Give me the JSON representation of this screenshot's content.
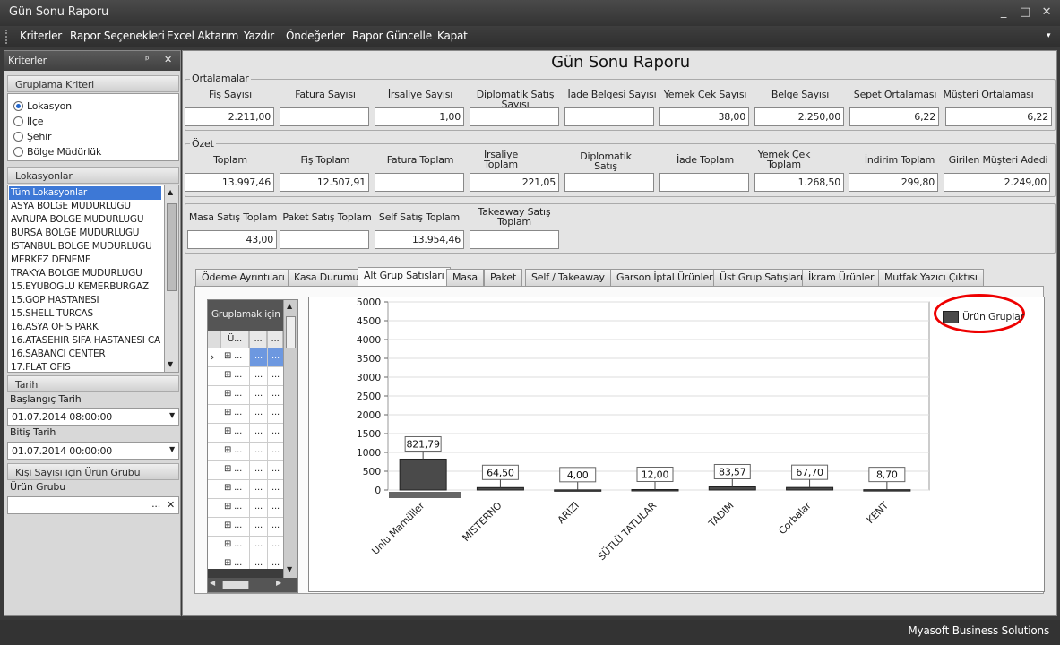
{
  "window": {
    "title": "Gün Sonu Raporu",
    "minimize": "_",
    "maximize": "□",
    "close": "✕"
  },
  "menu": [
    "Kriterler",
    "Rapor Seçenekleri",
    "Excel Aktarım",
    "Yazdır",
    "Öndeğerler",
    "Rapor Güncelle",
    "Kapat"
  ],
  "menu_overflow": "▾",
  "left_panel": {
    "title": "Kriterler",
    "pin": "ᵖ",
    "close": "✕",
    "grouping": {
      "title": "Gruplama Kriteri",
      "options": [
        "Lokasyon",
        "İlçe",
        "Şehir",
        "Bölge Müdürlük"
      ],
      "selected": "Lokasyon"
    },
    "locations": {
      "title": "Lokasyonlar",
      "items": [
        "Tüm Lokasyonlar",
        "ASYA BOLGE MUDURLUGU",
        "AVRUPA BOLGE MUDURLUGU",
        "BURSA BOLGE MUDURLUGU",
        "ISTANBUL BOLGE MUDURLUGU",
        "MERKEZ DENEME",
        "TRAKYA BOLGE MUDURLUGU",
        "15.EYUBOGLU KEMERBURGAZ",
        "15.GOP HASTANESI",
        "15.SHELL TURCAS",
        "16.ASYA OFIS PARK",
        "16.ATASEHIR SIFA HASTANESI CA",
        "16.SABANCI CENTER",
        "17.FLAT OFIS"
      ],
      "selected": "Tüm Lokasyonlar"
    },
    "date": {
      "title": "Tarih",
      "start_label": "Başlangıç Tarih",
      "start_value": "01.07.2014 08:00:00",
      "end_label": "Bitiş Tarih",
      "end_value": "01.07.2014 00:00:00"
    },
    "product": {
      "title": "Kişi Sayısı için Ürün Grubu",
      "label": "Ürün Grubu",
      "value": "",
      "ellipsis": "...",
      "clear": "✕"
    }
  },
  "report": {
    "title": "Gün Sonu Raporu",
    "averages": {
      "legend": "Ortalamalar",
      "fields": [
        {
          "label": "Fiş Sayısı",
          "value": "2.211,00"
        },
        {
          "label": "Fatura Sayısı",
          "value": ""
        },
        {
          "label": "İrsaliye Sayısı",
          "value": "1,00"
        },
        {
          "label": "Diplomatik Satış Sayısı",
          "value": ""
        },
        {
          "label": "İade Belgesi Sayısı",
          "value": ""
        },
        {
          "label": "Yemek Çek Sayısı",
          "value": "38,00"
        },
        {
          "label": "Belge Sayısı",
          "value": "2.250,00"
        },
        {
          "label": "Sepet Ortalaması",
          "value": "6,22"
        },
        {
          "label": "Müşteri Ortalaması",
          "value": "6,22"
        }
      ]
    },
    "summary": {
      "legend": "Özet",
      "fields": [
        {
          "label": "Toplam",
          "value": "13.997,46"
        },
        {
          "label": "Fiş Toplam",
          "value": "12.507,91"
        },
        {
          "label": "Fatura Toplam",
          "value": ""
        },
        {
          "label": "Irsaliye Toplam",
          "value": "221,05"
        },
        {
          "label": "Diplomatik Satış",
          "value": ""
        },
        {
          "label": "İade Toplam",
          "value": ""
        },
        {
          "label": "Yemek Çek Toplam",
          "value": "1.268,50"
        },
        {
          "label": "İndirim Toplam",
          "value": "299,80"
        },
        {
          "label": "Girilen Müşteri Adedi",
          "value": "2.249,00"
        }
      ]
    },
    "sales": [
      {
        "label": "Masa Satış Toplam",
        "value": "43,00"
      },
      {
        "label": "Paket Satış Toplam",
        "value": ""
      },
      {
        "label": "Self Satış Toplam",
        "value": "13.954,46"
      },
      {
        "label": "Takeaway Satış Toplam",
        "value": ""
      }
    ],
    "tabs": [
      "Ödeme Ayrıntıları",
      "Kasa Durumu",
      "Alt Grup Satışları",
      "Masa",
      "Paket",
      "Self / Takeaway",
      "Garson İptal Ürünler",
      "Üst Grup Satışları",
      "İkram Ürünler",
      "Mutfak Yazıcı Çıktısı"
    ],
    "active_tab": "Alt Grup Satışları",
    "grid": {
      "group_hint": "Gruplamak için l",
      "header": [
        "Ü...",
        "...",
        "..."
      ],
      "row_expand": "⊞",
      "row_cell": "...",
      "row_pointer": "›"
    }
  },
  "chart_data": {
    "type": "bar",
    "categories": [
      "Unlu Mamüller",
      "MISTERNO",
      "ARIZI",
      "SÜTLÜ TATLILAR",
      "TADIM",
      "Corbalar",
      "KENT"
    ],
    "series": [
      {
        "name": "Ürün Gruplar",
        "values": [
          821.79,
          64.5,
          4.0,
          12.0,
          83.57,
          67.7,
          8.7
        ]
      }
    ],
    "data_labels": [
      "821,79",
      "64,50",
      "4,00",
      "12,00",
      "83,57",
      "67,70",
      "8,70"
    ],
    "y_ticks": [
      "0",
      "500",
      "1000",
      "1500",
      "2000",
      "2500",
      "3000",
      "3500",
      "4000",
      "4500",
      "5000"
    ],
    "ylim": [
      0,
      5000
    ],
    "grid": true,
    "legend_position": "top-right",
    "bar_color": "#4a4a4a"
  },
  "status": {
    "company": "Myasoft Business Solutions"
  }
}
